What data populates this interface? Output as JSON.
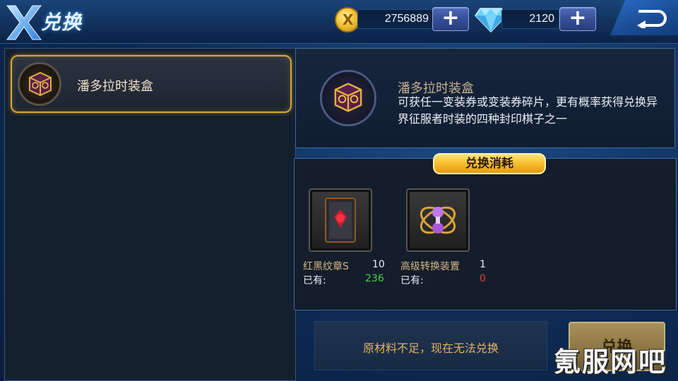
{
  "header": {
    "title": "兑换",
    "gold_amount": "2756889",
    "gem_amount": "2120",
    "plus_symbol": "+"
  },
  "list": {
    "items": [
      {
        "label": "潘多拉时装盒"
      }
    ]
  },
  "info": {
    "title": "潘多拉时装盒",
    "description": "可获任一变装券或变装券碎片，更有概率获得兑换异界征服者时装的四种封印棋子之一"
  },
  "cost": {
    "tab_label": "兑换消耗",
    "items": [
      {
        "name": "红黑纹章S",
        "required": "10",
        "owned_label": "已有:",
        "owned": "236",
        "owned_color": "#4cd04a"
      },
      {
        "name": "高级转换装置",
        "required": "1",
        "owned_label": "已有:",
        "owned": "0",
        "owned_color": "#e0452f"
      }
    ]
  },
  "footer": {
    "message": "原材料不足，现在无法兑换",
    "exchange_label": "兑换"
  },
  "watermark": "氪服网吧",
  "icons": [
    "x-logo-icon",
    "gold-coin-icon",
    "diamond-icon",
    "back-arrow-icon",
    "cube-box-icon",
    "emblem-card-icon",
    "converter-device-icon"
  ],
  "colors": {
    "accent_gold": "#d8a63a",
    "panel_border": "#3d6aa3",
    "owned_ok": "#4cd04a",
    "owned_lack": "#e0452f"
  }
}
